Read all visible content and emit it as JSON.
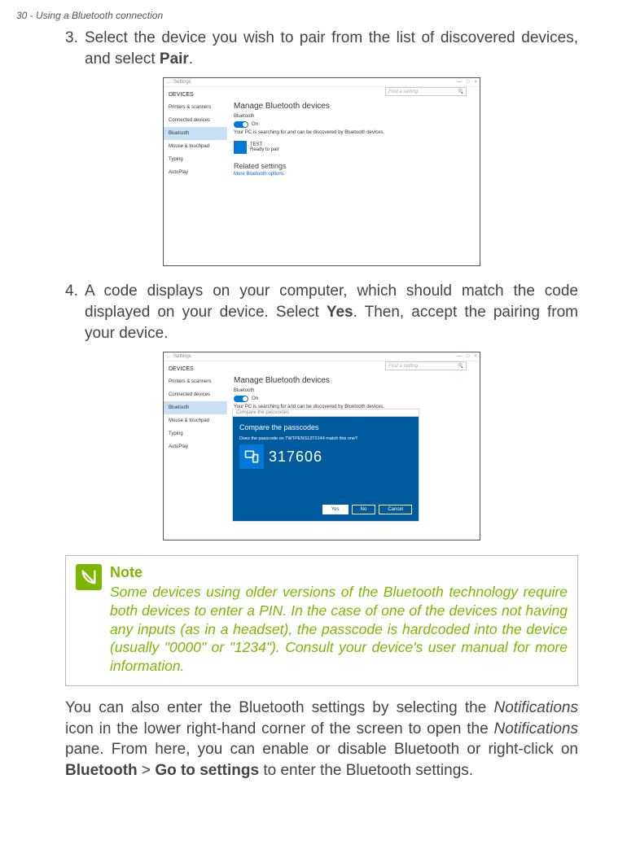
{
  "header": "30 - Using a Bluetooth connection",
  "step3": {
    "num": "3.",
    "text_a": "Select the device you wish to pair from the list of discovered devices, and select ",
    "bold": "Pair",
    "text_b": "."
  },
  "step4": {
    "num": "4.",
    "text_a": "A code displays on your computer, which should match the code displayed on your device. Select ",
    "bold": "Yes",
    "text_b": ". Then, accept the pairing from your device."
  },
  "shot_common": {
    "win_title": "Settings",
    "devices_head": "DEVICES",
    "sidebar": {
      "printers": "Printers & scanners",
      "connected": "Connected devices",
      "bluetooth": "Bluetooth",
      "mouse": "Mouse & touchpad",
      "typing": "Typing",
      "autoplay": "AutoPlay"
    },
    "search_ph": "Find a setting",
    "main_h": "Manage Bluetooth devices",
    "bt_label": "Bluetooth",
    "on": "On",
    "searching": "Your PC is searching for and can be discovered by Bluetooth devices."
  },
  "shot1": {
    "device_name": "TEST",
    "device_status": "Ready to pair",
    "related_h": "Related settings",
    "more_link": "More Bluetooth options"
  },
  "shot2": {
    "dlg_title": "Compare the passcodes",
    "dlg_h": "Compare the passcodes",
    "dlg_q": "Does the passcode on TWTPENS13T0144 match this one?",
    "code": "317606",
    "yes": "Yes",
    "no": "No",
    "cancel": "Cancel"
  },
  "note": {
    "title": "Note",
    "text": "Some devices using older versions of the Bluetooth technology require both devices to enter a PIN. In the case of one of the devices not having any inputs (as in a headset), the passcode is hardcoded into the device (usually \"0000\" or \"1234\"). Consult your device's user manual for more information."
  },
  "closing": {
    "a": "You can also enter the Bluetooth settings by selecting the ",
    "i1": "Notifications",
    "b": " icon in the lower right-hand corner of the screen to open the ",
    "i2": "Notifications",
    "c": " pane. From here, you can enable or disable Bluetooth or right-click on ",
    "b1": "Bluetooth",
    "gt": " > ",
    "b2": "Go to settings",
    "d": " to enter the Bluetooth settings."
  }
}
